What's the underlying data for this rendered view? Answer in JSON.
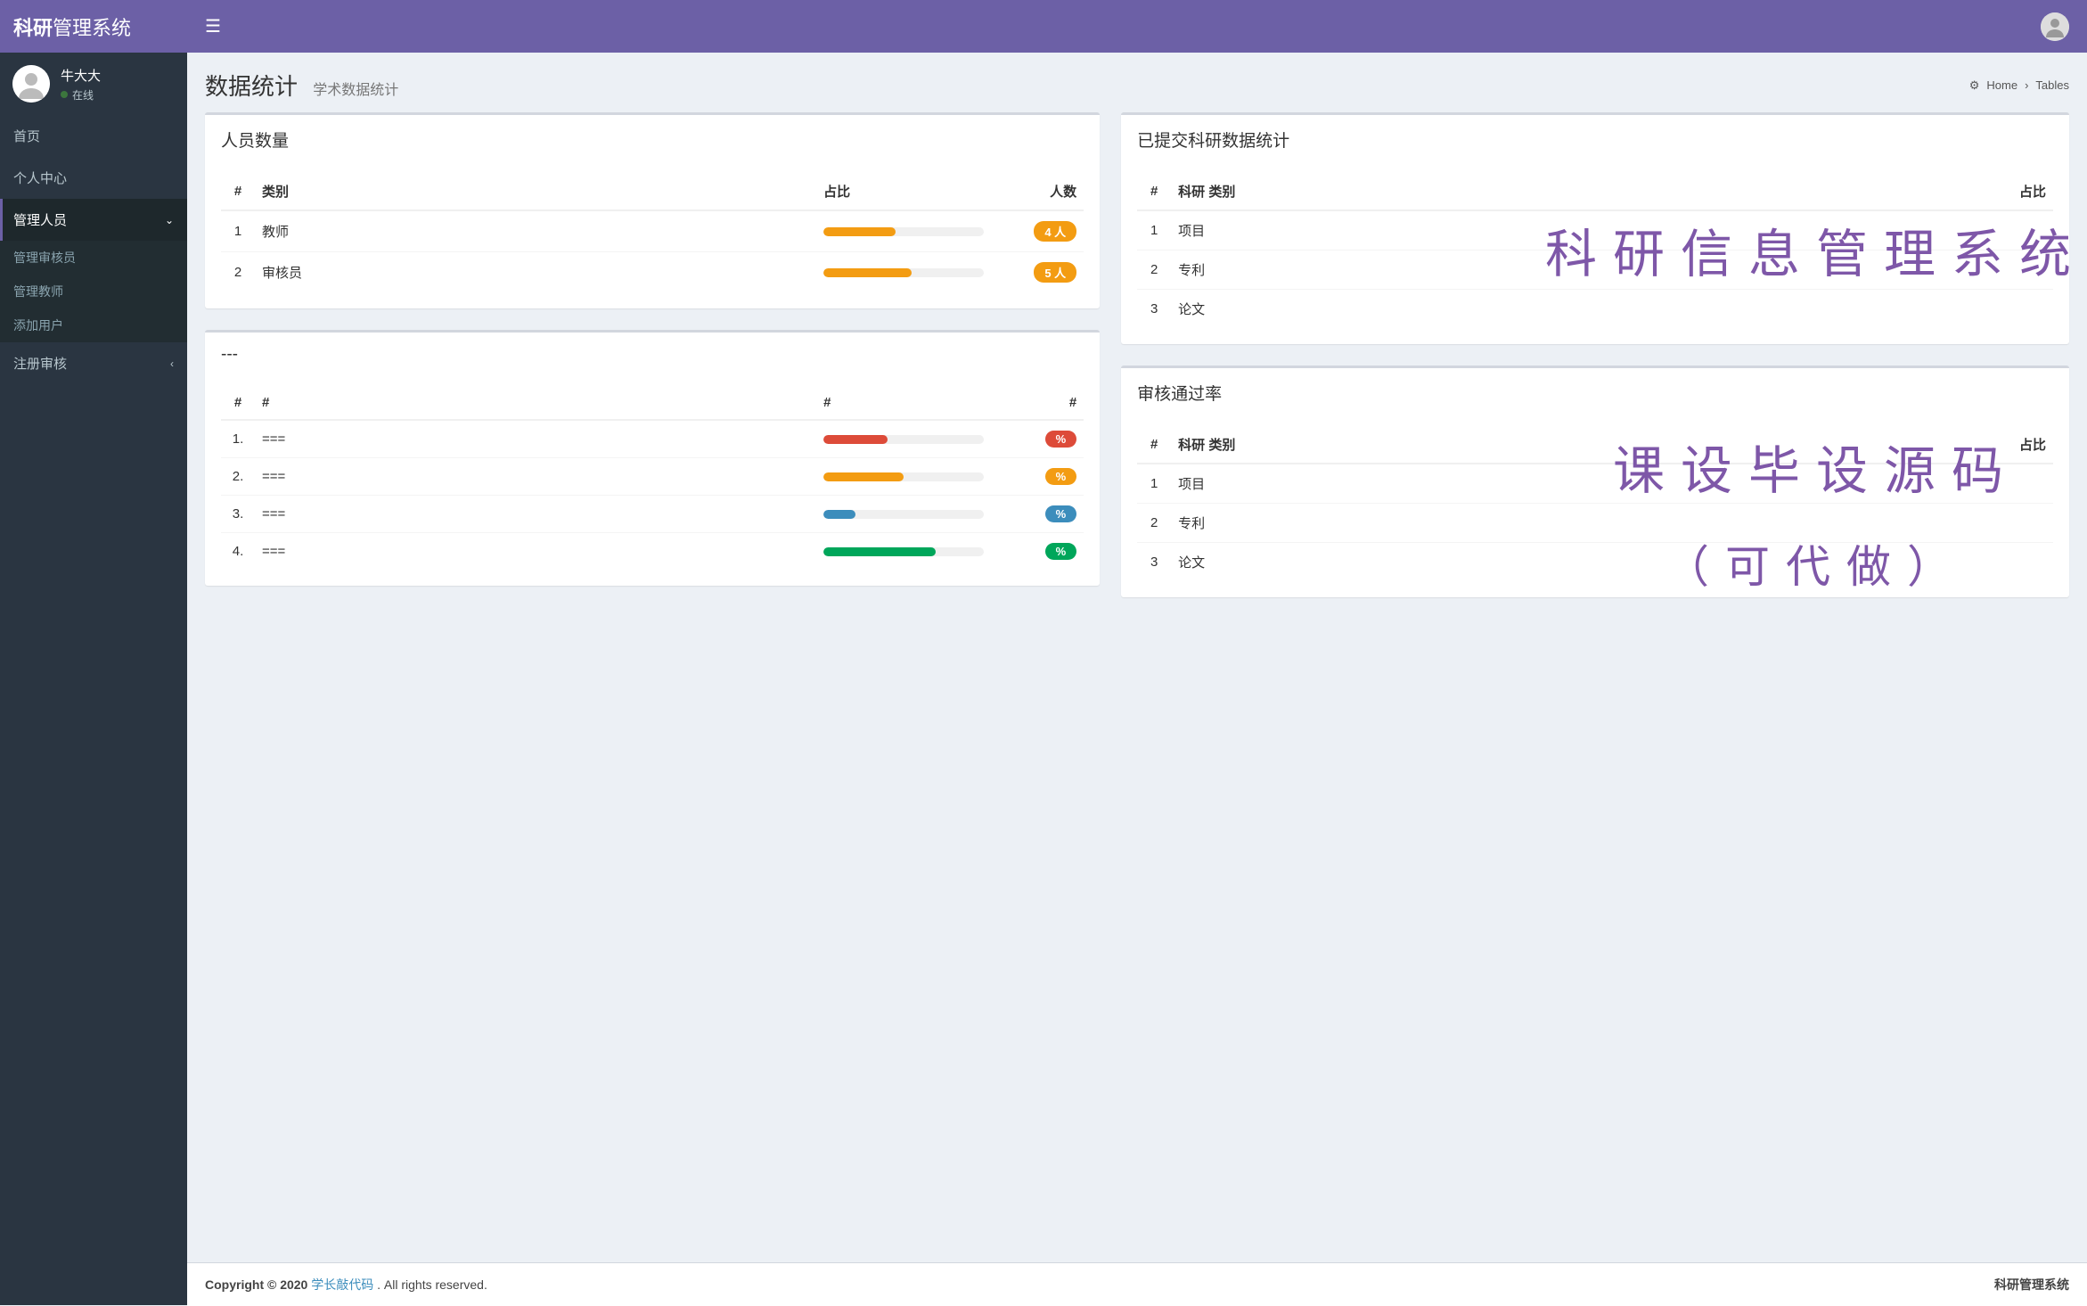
{
  "app": {
    "logo_bold": "科研",
    "logo_rest": "管理系统"
  },
  "user": {
    "name": "牛大大",
    "status": "在线"
  },
  "nav": {
    "home": "首页",
    "personal": "个人中心",
    "manage": "管理人员",
    "sub1": "管理审核员",
    "sub2": "管理教师",
    "sub3": "添加用户",
    "register": "注册审核"
  },
  "page": {
    "title": "数据统计",
    "subtitle": "学术数据统计"
  },
  "breadcrumb": {
    "home": "Home",
    "tables": "Tables"
  },
  "panels": {
    "personnel": {
      "title": "人员数量",
      "headers": {
        "idx": "#",
        "type": "类别",
        "ratio": "占比",
        "count": "人数"
      },
      "rows": [
        {
          "idx": "1",
          "type": "教师",
          "ratio": 45,
          "count": "4 人",
          "color": "orange"
        },
        {
          "idx": "2",
          "type": "审核员",
          "ratio": 55,
          "count": "5 人",
          "color": "orange"
        }
      ]
    },
    "unknown": {
      "title": "---",
      "headers": {
        "idx": "#",
        "type": "#",
        "ratio": "#",
        "count": "#"
      },
      "rows": [
        {
          "idx": "1.",
          "type": "===",
          "ratio": 40,
          "count": "%",
          "color": "red"
        },
        {
          "idx": "2.",
          "type": "===",
          "ratio": 50,
          "count": "%",
          "color": "orange"
        },
        {
          "idx": "3.",
          "type": "===",
          "ratio": 20,
          "count": "%",
          "color": "blue"
        },
        {
          "idx": "4.",
          "type": "===",
          "ratio": 70,
          "count": "%",
          "color": "green"
        }
      ]
    },
    "submitted": {
      "title": "已提交科研数据统计",
      "headers": {
        "idx": "#",
        "type": "科研 类别",
        "ratio": "占比"
      },
      "rows": [
        {
          "idx": "1",
          "type": "项目"
        },
        {
          "idx": "2",
          "type": "专利"
        },
        {
          "idx": "3",
          "type": "论文"
        }
      ]
    },
    "passrate": {
      "title": "审核通过率",
      "headers": {
        "idx": "#",
        "type": "科研 类别",
        "ratio": "占比"
      },
      "rows": [
        {
          "idx": "1",
          "type": "项目"
        },
        {
          "idx": "2",
          "type": "专利"
        },
        {
          "idx": "3",
          "type": "论文"
        }
      ]
    }
  },
  "footer": {
    "copyright": "Copyright © 2020 ",
    "link": "学长敲代码",
    "rights": ". All rights reserved.",
    "right": "科研管理系统"
  },
  "watermark": {
    "l1": "科研信息管理系统",
    "l2": "课设毕设源码",
    "l3": "（可代做）"
  }
}
